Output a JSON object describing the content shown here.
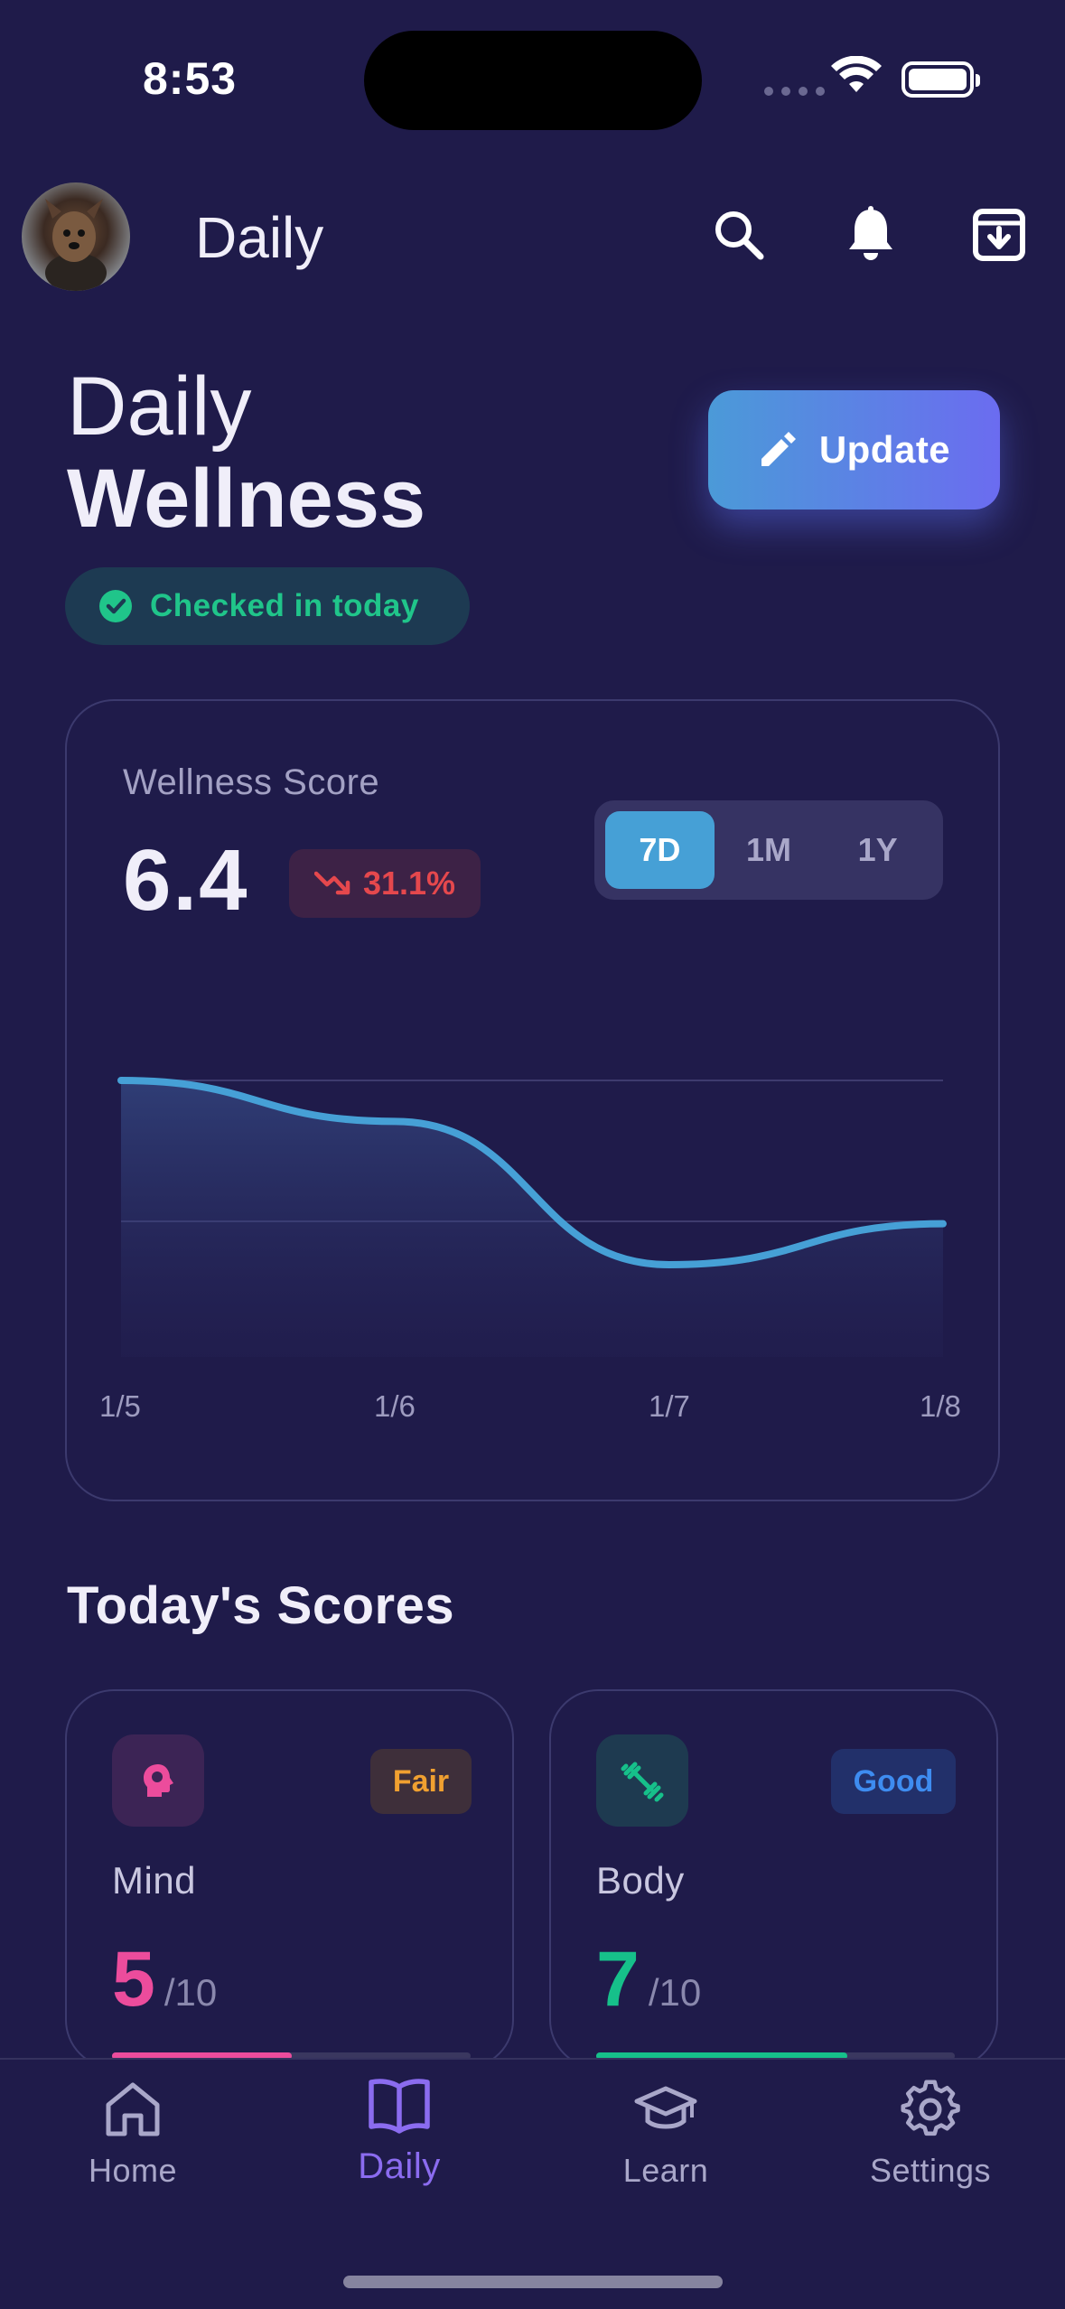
{
  "status_bar": {
    "time": "8:53"
  },
  "header": {
    "title": "Daily",
    "icons": [
      "search-icon",
      "bell-icon",
      "archive-icon"
    ]
  },
  "hero": {
    "title_light": "Daily",
    "title_bold": "Wellness",
    "status": "Checked in today",
    "update_label": "Update"
  },
  "wellness_card": {
    "label": "Wellness Score",
    "score": "6.4",
    "delta": "31.1%",
    "ranges": [
      "7D",
      "1M",
      "1Y"
    ],
    "active_range": "7D"
  },
  "chart_data": {
    "type": "area",
    "x": [
      "1/5",
      "1/6",
      "1/7",
      "1/8"
    ],
    "series": [
      {
        "values": [
          7.6,
          7.2,
          5.8,
          6.2
        ]
      }
    ],
    "grid": true,
    "color": "#46a0d6"
  },
  "scores": {
    "title": "Today's Scores",
    "items": [
      {
        "name": "Mind",
        "value": "5",
        "max": "/10",
        "badge": "Fair",
        "color": "#ec4c9c",
        "badge_color": "#f0a030",
        "fraction": 0.5,
        "icon": "brain-icon"
      },
      {
        "name": "Body",
        "value": "7",
        "max": "/10",
        "badge": "Good",
        "color": "#16c08a",
        "badge_color": "#3e8cf0",
        "fraction": 0.7,
        "icon": "dumbbell-icon"
      }
    ]
  },
  "nav": {
    "items": [
      {
        "label": "Home",
        "icon": "home-icon"
      },
      {
        "label": "Daily",
        "icon": "book-icon",
        "active": true
      },
      {
        "label": "Learn",
        "icon": "graduation-cap-icon"
      },
      {
        "label": "Settings",
        "icon": "gear-icon"
      }
    ]
  }
}
